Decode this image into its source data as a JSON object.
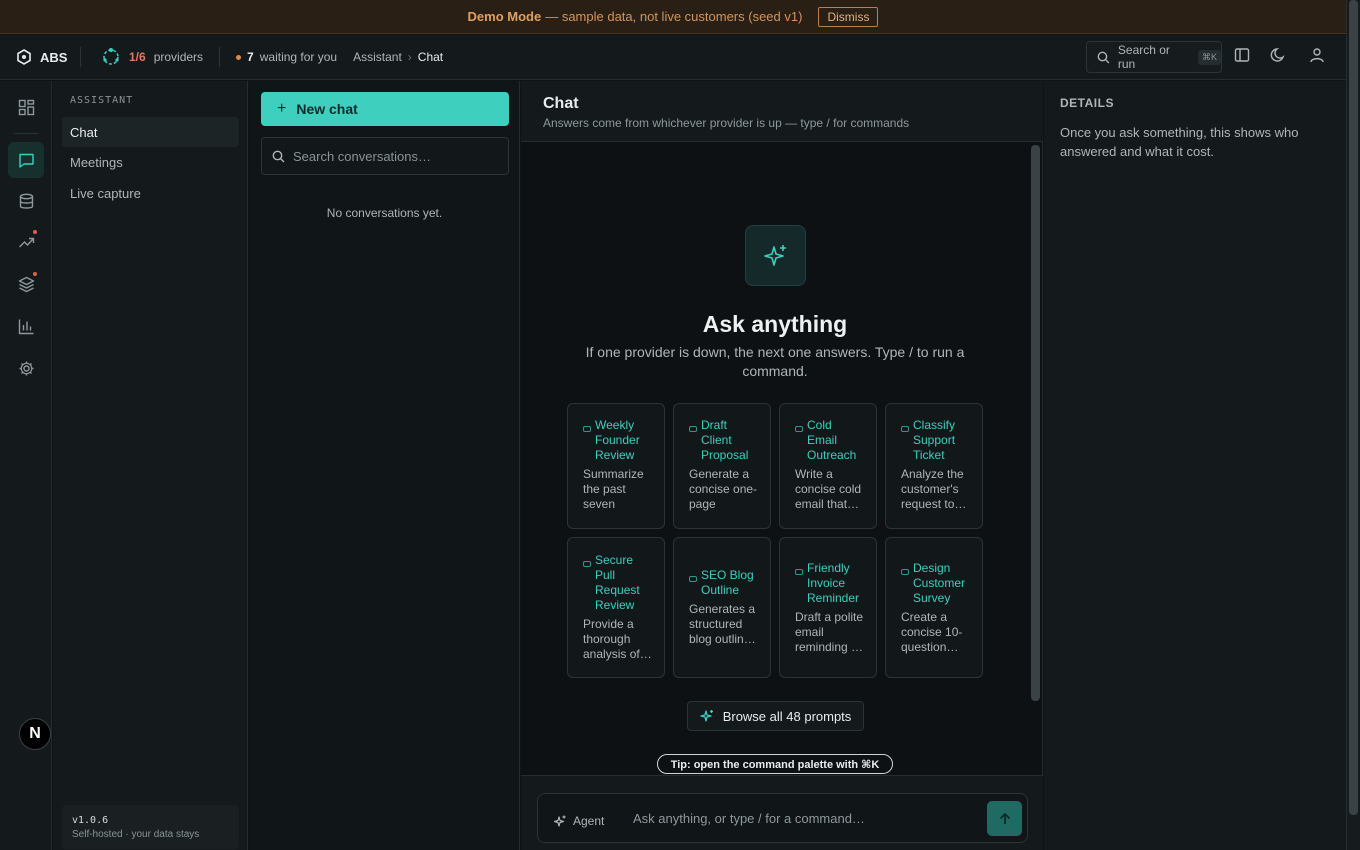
{
  "banner": {
    "mode": "Demo Mode",
    "text": "— sample data, not live customers (seed v1)",
    "dismiss": "Dismiss"
  },
  "topbar": {
    "logo": "ABS",
    "providers_count": "1/6",
    "providers_label": "providers",
    "waiting_count": "7",
    "waiting_label": "waiting for you",
    "breadcrumb": [
      "Assistant",
      "Chat"
    ],
    "search_label": "Search or run",
    "search_shortcut": "⌘K"
  },
  "rail": {
    "icons": [
      "dashboard-icon",
      "chat-icon",
      "database-icon",
      "trending-icon",
      "layers-icon",
      "bar-chart-icon",
      "gear-icon"
    ],
    "avatar": "N"
  },
  "subnav": {
    "title": "ASSISTANT",
    "items": [
      "Chat",
      "Meetings",
      "Live capture"
    ],
    "version": "v1.0.6",
    "version_sub": "Self-hosted · your data stays"
  },
  "conversations": {
    "new_chat": "New chat",
    "search_placeholder": "Search conversations…",
    "empty": "No conversations yet."
  },
  "chat": {
    "title": "Chat",
    "subtitle": "Answers come from whichever provider is up — type / for commands",
    "hero_title": "Ask anything",
    "hero_sub": "If one provider is down, the next one answers. Type / to run a command.",
    "cards": [
      {
        "title": "Weekly Founder Review",
        "desc": "Summarize the past seven days,…"
      },
      {
        "title": "Draft Client Proposal",
        "desc": "Generate a concise one-page client…"
      },
      {
        "title": "Cold Email Outreach",
        "desc": "Write a concise cold email that…"
      },
      {
        "title": "Classify Support Ticket",
        "desc": "Analyze the customer's request to…"
      },
      {
        "title": "Secure Pull Request Review",
        "desc": "Provide a thorough analysis of…"
      },
      {
        "title": "SEO Blog Outline",
        "desc": "Generates a structured blog outlin…"
      },
      {
        "title": "Friendly Invoice Reminder",
        "desc": "Draft a polite email reminding …"
      },
      {
        "title": "Design Customer Survey",
        "desc": "Create a concise 10-question…"
      }
    ],
    "browse": "Browse all 48 prompts",
    "tip": "Tip: open the command palette with ⌘K",
    "agent": "Agent",
    "input_placeholder": "Ask anything, or type / for a command…"
  },
  "details": {
    "title": "DETAILS",
    "text": "Once you ask something, this shows who answered and what it cost."
  },
  "colors": {
    "accent": "#3ecfbf",
    "banner_bg": "#2a1f14",
    "warning": "#e07a5f"
  }
}
